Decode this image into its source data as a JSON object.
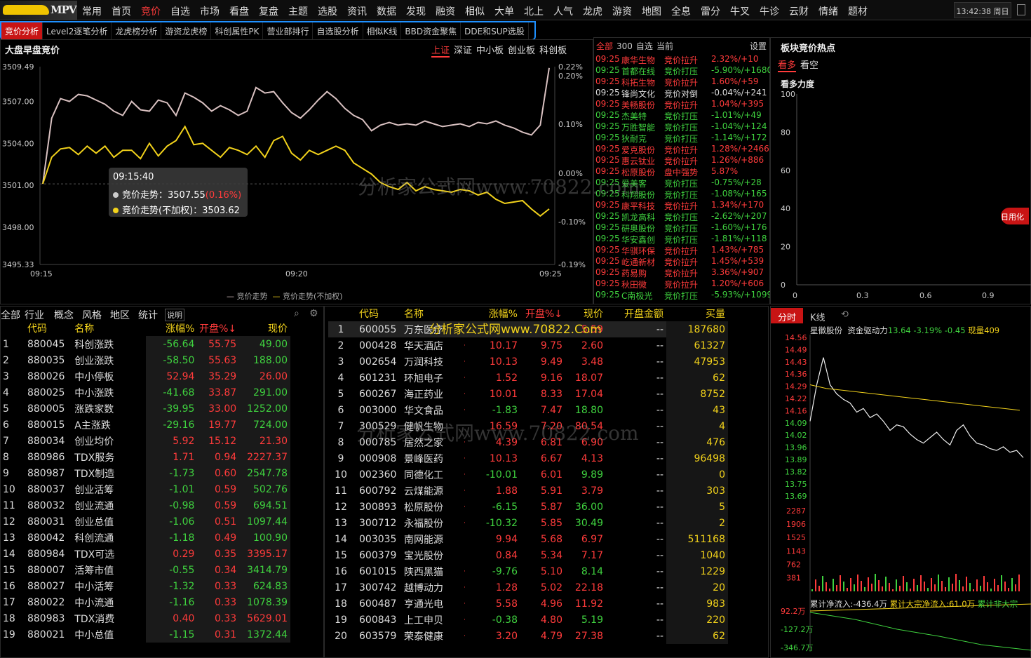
{
  "logo": {
    "text": "MPV"
  },
  "menu": [
    "常用",
    "首页",
    "竞价",
    "自选",
    "市场",
    "看盘",
    "复盘",
    "主题",
    "选股",
    "资讯",
    "数据",
    "发现",
    "融资",
    "相似",
    "大单",
    "北上",
    "人气",
    "龙虎",
    "游资",
    "地图",
    "全息",
    "雷分",
    "牛叉",
    "牛诊",
    "云财",
    "情绪",
    "题材"
  ],
  "menu_active": 2,
  "clock": "13:42:38 周日",
  "subnav": [
    "竞价分析",
    "Level2逐笔分析",
    "龙虎榜分析",
    "游资龙虎榜",
    "科创属性PK",
    "营业部排行",
    "自选股分析",
    "相似K线",
    "BBD资金聚焦",
    "DDE和SUP选股"
  ],
  "chart_panel": {
    "title": "大盘早盘竞价",
    "tabs": [
      "上证",
      "深证",
      "中小板",
      "创业板",
      "科创板"
    ],
    "legend1": "竞价走势",
    "legend2": "竞价走势(不加权)",
    "tooltip": {
      "time": "09:15:40",
      "l1": "竞价走势：",
      "v1": "3507.55",
      "p1": "(0.16%)",
      "l2": "竞价走势(不加权)：",
      "v2": "3503.62"
    }
  },
  "chart_data": {
    "type": "line",
    "x_ticks": [
      "09:15",
      "09:20",
      "09:25"
    ],
    "y_left_ticks": [
      "3509.49",
      "3507.00",
      "3504.00",
      "3501.00",
      "3498.00",
      "3495.33"
    ],
    "y_left_range": [
      3495.33,
      3509.49
    ],
    "y_right_ticks": [
      "0.22%",
      "0.20%",
      "0.10%",
      "0.00%",
      "-0.10%",
      "-0.19%"
    ],
    "series": [
      {
        "name": "竞价走势",
        "color": "#d9c1c1",
        "values": [
          3501.1,
          3505.8,
          3507.2,
          3507.0,
          3507.5,
          3507.4,
          3507.1,
          3506.8,
          3506.3,
          3506.0,
          3507.0,
          3506.4,
          3506.3,
          3507.1,
          3506.9,
          3506.0,
          3507.6,
          3507.3,
          3506.9,
          3506.3,
          3506.7,
          3506.4,
          3506.0,
          3506.3,
          3508.0,
          3507.6,
          3507.7,
          3506.9,
          3506.2,
          3505.8,
          3506.4,
          3507.1,
          3507.7,
          3507.2,
          3506.5,
          3506.0,
          3505.7,
          3504.9,
          3505.3,
          3505.5,
          3505.3,
          3505.4,
          3505.3,
          3505.6,
          3505.4,
          3505.2,
          3505.3,
          3505.4,
          3505.2,
          3505.5,
          3505.4,
          3505.6,
          3505.3,
          3505.1,
          3504.8,
          3504.6,
          3505.3,
          3509.4
        ]
      },
      {
        "name": "竞价走势(不加权)",
        "color": "#f2d21b",
        "values": [
          3501.1,
          3503.0,
          3503.6,
          3503.7,
          3503.2,
          3503.8,
          3503.3,
          3503.8,
          3503.0,
          3503.5,
          3503.5,
          3502.9,
          3504.0,
          3503.1,
          3503.8,
          3504.2,
          3505.2,
          3503.9,
          3504.0,
          3503.5,
          3503.0,
          3503.7,
          3503.5,
          3503.2,
          3503.8,
          3503.0,
          3504.2,
          3504.5,
          3503.3,
          3502.8,
          3503.5,
          3503.2,
          3503.5,
          3503.8,
          3503.5,
          3502.6,
          3502.2,
          3501.8,
          3501.2,
          3500.9,
          3500.7,
          3501.2,
          3500.6,
          3500.9,
          3500.7,
          3500.6,
          3500.5,
          3500.7,
          3500.6,
          3500.3,
          3500.5,
          3500.0,
          3499.7,
          3499.8,
          3499.9,
          3499.3,
          3498.8,
          3499.3
        ]
      }
    ]
  },
  "auction_list": {
    "tabs": [
      "全部",
      "300",
      "自选",
      "当前"
    ],
    "settings": "设置",
    "rows": [
      [
        "09:25",
        "康华生物",
        "竞价拉升",
        "2.32%/+10",
        "r"
      ],
      [
        "09:25",
        "首都在线",
        "竞价打压",
        "-5.90%/+1680",
        "g"
      ],
      [
        "09:25",
        "科拓生物",
        "竞价拉升",
        "1.60%/+59",
        "r"
      ],
      [
        "09:25",
        "锋尚文化",
        "竞价对倒",
        "-0.04%/+241",
        "w"
      ],
      [
        "09:25",
        "美畅股份",
        "竞价拉升",
        "1.04%/+395",
        "r"
      ],
      [
        "09:25",
        "杰美特",
        "竞价打压",
        "-1.01%/+49",
        "g"
      ],
      [
        "09:25",
        "万胜智能",
        "竞价打压",
        "-1.04%/+124",
        "g"
      ],
      [
        "09:25",
        "狄耐克",
        "竞价打压",
        "-1.14%/+172",
        "g"
      ],
      [
        "09:25",
        "爱克股份",
        "竞价拉升",
        "1.28%/+2466",
        "r"
      ],
      [
        "09:25",
        "惠云钛业",
        "竞价拉升",
        "1.26%/+886",
        "r"
      ],
      [
        "09:25",
        "松原股份",
        "盘中强势",
        "5.87%",
        "r"
      ],
      [
        "09:25",
        "爱美客",
        "竞价打压",
        "-0.75%/+28",
        "g"
      ],
      [
        "09:25",
        "科翔股份",
        "竞价打压",
        "-1.08%/+165",
        "g"
      ],
      [
        "09:25",
        "康平科技",
        "竞价拉升",
        "1.34%/+170",
        "r"
      ],
      [
        "09:25",
        "凯龙高科",
        "竞价打压",
        "-2.62%/+207",
        "g"
      ],
      [
        "09:25",
        "研奥股份",
        "竞价打压",
        "-1.60%/+176",
        "g"
      ],
      [
        "09:25",
        "华安鑫创",
        "竞价打压",
        "-1.81%/+118",
        "g"
      ],
      [
        "09:25",
        "华骐环保",
        "竞价拉升",
        "1.43%/+785",
        "r"
      ],
      [
        "09:25",
        "屹通新材",
        "竞价拉升",
        "1.45%/+539",
        "r"
      ],
      [
        "09:25",
        "药易购",
        "竞价拉升",
        "3.36%/+907",
        "r"
      ],
      [
        "09:25",
        "秋田微",
        "竞价拉升",
        "1.20%/+606",
        "r"
      ],
      [
        "09:25",
        "C南极光",
        "竞价打压",
        "-5.93%/+1099",
        "g"
      ]
    ]
  },
  "hot": {
    "title": "板块竞价热点",
    "tabs": [
      "看多",
      "看空"
    ],
    "sub": "看多力度",
    "y": [
      "100",
      "80",
      "60",
      "40",
      "20",
      "0"
    ],
    "x": [
      "0",
      "0.3",
      "0.6",
      "0.9"
    ],
    "side": "日用化"
  },
  "left_table": {
    "tabs": [
      "全部",
      "行业",
      "概念",
      "风格",
      "地区",
      "统计"
    ],
    "help": "说明",
    "headers": [
      "",
      "代码",
      "名称",
      "",
      "涨幅%",
      "开盘%↓",
      "现价"
    ],
    "rows": [
      [
        "1",
        "880045",
        "科创涨跌",
        "-56.64",
        "55.75",
        "49.00"
      ],
      [
        "2",
        "880035",
        "创业涨跌",
        "-58.50",
        "55.63",
        "188.00"
      ],
      [
        "3",
        "880026",
        "中小停板",
        "52.94",
        "35.29",
        "26.00"
      ],
      [
        "4",
        "880025",
        "中小涨跌",
        "-41.68",
        "33.87",
        "291.00"
      ],
      [
        "5",
        "880005",
        "涨跌家数",
        "-39.95",
        "33.00",
        "1252.00"
      ],
      [
        "6",
        "880015",
        "A主涨跌",
        "-29.16",
        "19.77",
        "724.00"
      ],
      [
        "7",
        "880034",
        "创业均价",
        "5.92",
        "15.12",
        "21.30"
      ],
      [
        "8",
        "880986",
        "TDX服务",
        "1.71",
        "0.94",
        "2227.37"
      ],
      [
        "9",
        "880987",
        "TDX制造",
        "-1.73",
        "0.60",
        "2547.78"
      ],
      [
        "10",
        "880037",
        "创业活筹",
        "-1.01",
        "0.59",
        "502.76"
      ],
      [
        "11",
        "880032",
        "创业流通",
        "-0.98",
        "0.59",
        "694.51"
      ],
      [
        "12",
        "880031",
        "创业总值",
        "-1.06",
        "0.51",
        "1097.44"
      ],
      [
        "13",
        "880042",
        "科创流通",
        "-1.18",
        "0.49",
        "100.90"
      ],
      [
        "14",
        "880984",
        "TDX可选",
        "0.29",
        "0.35",
        "3395.17"
      ],
      [
        "15",
        "880007",
        "活筹市值",
        "-0.55",
        "0.34",
        "3414.79"
      ],
      [
        "16",
        "880027",
        "中小活筹",
        "-1.32",
        "0.33",
        "624.83"
      ],
      [
        "17",
        "880022",
        "中小流通",
        "-1.16",
        "0.33",
        "1078.39"
      ],
      [
        "18",
        "880983",
        "TDX消费",
        "0.40",
        "0.33",
        "5629.01"
      ],
      [
        "19",
        "880021",
        "中小总值",
        "-1.15",
        "0.31",
        "1372.44"
      ]
    ]
  },
  "mid_table": {
    "headers": [
      "",
      "代码",
      "名称",
      "",
      "涨幅%",
      "开盘%↓",
      "现价",
      "开盘金额",
      "买量"
    ],
    "rows": [
      [
        "1",
        "600055",
        "万东医疗",
        "",
        "",
        "",
        "5.59",
        "--",
        "187680"
      ],
      [
        "2",
        "000428",
        "华天酒店",
        "·",
        "10.17",
        "9.75",
        "2.60",
        "--",
        "61327"
      ],
      [
        "3",
        "002654",
        "万润科技",
        "·",
        "10.13",
        "9.49",
        "3.48",
        "--",
        "47953"
      ],
      [
        "4",
        "601231",
        "环旭电子",
        "·",
        "1.52",
        "9.16",
        "18.07",
        "--",
        "62"
      ],
      [
        "5",
        "600267",
        "海正药业",
        "·",
        "10.01",
        "8.33",
        "17.04",
        "--",
        "8752"
      ],
      [
        "6",
        "003000",
        "华文食品",
        "·",
        "-1.83",
        "7.47",
        "18.80",
        "--",
        "43"
      ],
      [
        "7",
        "300529",
        "健帆生物",
        "",
        "16.59",
        "7.20",
        "80.54",
        "--",
        "4"
      ],
      [
        "8",
        "000785",
        "居然之家",
        "·",
        "4.39",
        "6.81",
        "6.90",
        "--",
        "476"
      ],
      [
        "9",
        "000908",
        "景峰医药",
        "·",
        "10.13",
        "6.67",
        "4.13",
        "--",
        "96498"
      ],
      [
        "10",
        "002360",
        "同德化工",
        "·",
        "-10.01",
        "6.01",
        "9.89",
        "--",
        "0"
      ],
      [
        "11",
        "600792",
        "云煤能源",
        "·",
        "1.88",
        "5.91",
        "3.79",
        "--",
        "303"
      ],
      [
        "12",
        "300893",
        "松原股份",
        "·",
        "-6.15",
        "5.87",
        "36.00",
        "--",
        "5"
      ],
      [
        "13",
        "300712",
        "永福股份",
        "·",
        "-10.32",
        "5.85",
        "30.49",
        "--",
        "2"
      ],
      [
        "14",
        "003035",
        "南网能源",
        "",
        "9.94",
        "5.68",
        "6.97",
        "--",
        "511168"
      ],
      [
        "15",
        "600379",
        "宝光股份",
        "",
        "0.84",
        "5.34",
        "7.17",
        "--",
        "1040"
      ],
      [
        "16",
        "601015",
        "陕西黑猫",
        "·",
        "-9.76",
        "5.10",
        "8.14",
        "--",
        "1229"
      ],
      [
        "17",
        "300742",
        "越博动力",
        "·",
        "1.28",
        "5.02",
        "22.18",
        "--",
        "20"
      ],
      [
        "18",
        "600487",
        "亨通光电",
        "·",
        "5.58",
        "4.96",
        "11.92",
        "--",
        "983"
      ],
      [
        "19",
        "600843",
        "上工申贝",
        "·",
        "-0.38",
        "4.80",
        "5.19",
        "--",
        "220"
      ],
      [
        "20",
        "603579",
        "荣泰健康",
        "·",
        "3.20",
        "4.79",
        "27.38",
        "--",
        "62"
      ]
    ]
  },
  "mini": {
    "tabs": [
      "分时",
      "K线"
    ],
    "name": "星徽股份",
    "label": "资金驱动力",
    "v1": "13.64",
    "v2": "-3.19%",
    "v3": "-0.45",
    "v4": "现量409",
    "y": [
      "14.56",
      "14.49",
      "14.43",
      "14.36",
      "14.29",
      "14.22",
      "14.16",
      "14.09",
      "14.02",
      "13.96",
      "13.89",
      "13.82",
      "13.75",
      "13.69"
    ],
    "vol": [
      "2287",
      "1906",
      "1525",
      "1143",
      "762",
      "381"
    ],
    "flow": "累计净流入:-436.4万",
    "flow2": "累计大宗净流入:61.0万",
    "flow3": "累计非大宗",
    "fy": [
      "92.2万",
      "-127.2万",
      "-346.7万"
    ]
  },
  "watermarks": [
    "分析家公式网www.70822.com",
    "分析家公式网www.70822.Com",
    "分析家公式网www.70822.com"
  ]
}
